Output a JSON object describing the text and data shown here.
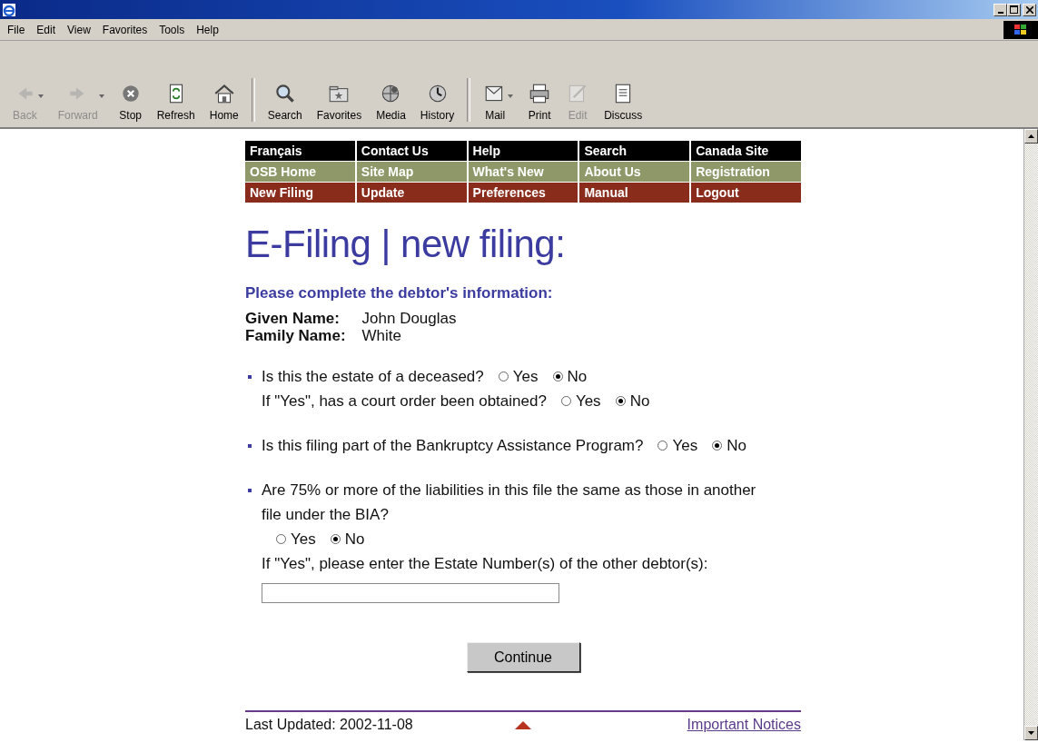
{
  "menu": [
    {
      "label": "File"
    },
    {
      "label": "Edit"
    },
    {
      "label": "View"
    },
    {
      "label": "Favorites"
    },
    {
      "label": "Tools"
    },
    {
      "label": "Help"
    }
  ],
  "toolbar": [
    [
      {
        "label": "Back",
        "disabled": true,
        "dropdown": true
      },
      {
        "label": "Forward",
        "disabled": true,
        "dropdown": true
      },
      {
        "label": "Stop",
        "disabled": false,
        "dropdown": false
      },
      {
        "label": "Refresh",
        "disabled": false,
        "dropdown": false
      },
      {
        "label": "Home",
        "disabled": false,
        "dropdown": false
      }
    ],
    [
      {
        "label": "Search",
        "disabled": false,
        "dropdown": false
      },
      {
        "label": "Favorites",
        "disabled": false,
        "dropdown": false
      },
      {
        "label": "Media",
        "disabled": false,
        "dropdown": false
      },
      {
        "label": "History",
        "disabled": false,
        "dropdown": false
      }
    ],
    [
      {
        "label": "Mail",
        "disabled": false,
        "dropdown": true
      },
      {
        "label": "Print",
        "disabled": false,
        "dropdown": false
      },
      {
        "label": "Edit",
        "disabled": true,
        "dropdown": false
      },
      {
        "label": "Discuss",
        "disabled": false,
        "dropdown": false
      }
    ]
  ],
  "nav": [
    {
      "color": "#000000",
      "items": [
        "Français",
        "Contact Us",
        "Help",
        "Search",
        "Canada Site"
      ]
    },
    {
      "color": "#8e9868",
      "items": [
        "OSB Home",
        "Site Map",
        "What's New",
        "About Us",
        "Registration"
      ]
    },
    {
      "color": "#8a2c1c",
      "items": [
        "New Filing",
        "Update",
        "Preferences",
        "Manual",
        "Logout"
      ]
    }
  ],
  "heading": "E-Filing | new filing:",
  "instruction": "Please complete the debtor's information:",
  "debtor": [
    {
      "label": "Given Name:",
      "value": "John Douglas"
    },
    {
      "label": "Family Name:",
      "value": "White"
    }
  ],
  "questions": [
    {
      "bullet": true,
      "text": "Is this the estate of a deceased?",
      "options": [
        {
          "label": "Yes",
          "selected": false
        },
        {
          "label": "No",
          "selected": true
        }
      ]
    },
    {
      "bullet": false,
      "text": "If \"Yes\", has a court order been obtained?",
      "options": [
        {
          "label": "Yes",
          "selected": false
        },
        {
          "label": "No",
          "selected": true
        }
      ]
    },
    {
      "bullet": true,
      "text": "Is this filing part of the Bankruptcy Assistance Program?",
      "options": [
        {
          "label": "Yes",
          "selected": false
        },
        {
          "label": "No",
          "selected": true
        }
      ]
    },
    {
      "bullet": true,
      "text": "Are 75% or more of the liabilities in this file the same as those in another file under the BIA?",
      "options": [
        {
          "label": "Yes",
          "selected": false
        },
        {
          "label": "No",
          "selected": true
        }
      ]
    }
  ],
  "estate_prompt": "If \"Yes\", please enter the Estate Number(s) of the other debtor(s):",
  "continue_button": "Continue",
  "footer": {
    "last_updated": "Last Updated: 2002-11-08",
    "link": "Important Notices"
  }
}
